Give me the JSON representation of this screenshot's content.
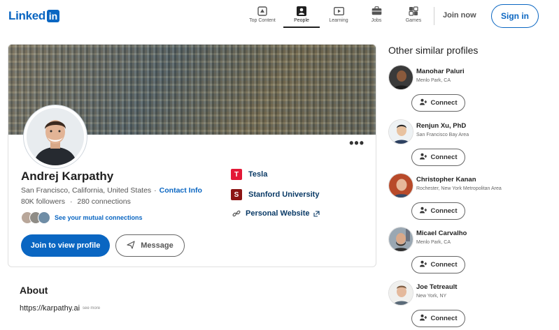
{
  "nav": {
    "logo_text": "Linked",
    "logo_box": "in",
    "items": [
      {
        "label": "Top Content",
        "icon": "top-content-icon"
      },
      {
        "label": "People",
        "icon": "people-icon"
      },
      {
        "label": "Learning",
        "icon": "learning-icon"
      },
      {
        "label": "Jobs",
        "icon": "jobs-icon"
      },
      {
        "label": "Games",
        "icon": "games-icon"
      }
    ],
    "active_item": "People",
    "join_now": "Join now",
    "sign_in": "Sign in"
  },
  "profile": {
    "name": "Andrej Karpathy",
    "location": "San Francisco, California, United States",
    "separator": "·",
    "contact_info": "Contact Info",
    "followers": "80K followers",
    "connections": "280 connections",
    "mutual_connections": "See your mutual connections",
    "join_button": "Join to view profile",
    "message_button": "Message",
    "more_button": "•••",
    "experience": [
      {
        "label": "Tesla",
        "icon": "tesla-logo-icon",
        "logo_text": "T",
        "color": "#e31937"
      },
      {
        "label": "Stanford University",
        "icon": "stanford-logo-icon",
        "logo_text": "S",
        "color": "#8c1515"
      },
      {
        "label": "Personal Website",
        "icon": "link-icon"
      }
    ]
  },
  "about": {
    "title": "About",
    "link": "https://karpathy.ai",
    "extra": "see more"
  },
  "sidebar": {
    "title": "Other similar profiles",
    "connect_label": "Connect",
    "people": [
      {
        "name": "Manohar Paluri",
        "location": "Menlo Park, CA"
      },
      {
        "name": "Renjun Xu, PhD",
        "location": "San Francisco Bay Area"
      },
      {
        "name": "Christopher Kanan",
        "location": "Rochester, New York Metropolitan Area"
      },
      {
        "name": "Micael Carvalho",
        "location": "Menlo Park, CA"
      },
      {
        "name": "Joe Tetreault",
        "location": "New York, NY"
      }
    ]
  },
  "colors": {
    "brand": "#0a66c2",
    "tesla": "#e31937",
    "stanford": "#8c1515"
  }
}
